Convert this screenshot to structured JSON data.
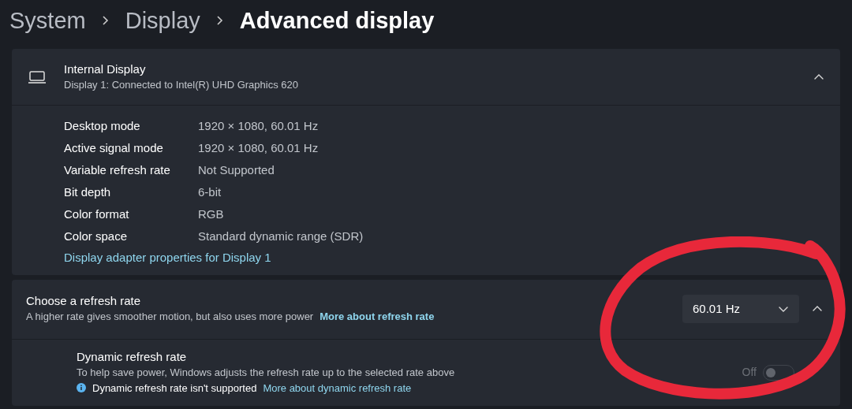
{
  "breadcrumb": [
    "System",
    "Display",
    "Advanced display"
  ],
  "display_card": {
    "title": "Internal Display",
    "subtitle": "Display 1: Connected to Intel(R) UHD Graphics 620",
    "expanded": true,
    "details": [
      {
        "label": "Desktop mode",
        "value": "1920 × 1080, 60.01 Hz"
      },
      {
        "label": "Active signal mode",
        "value": "1920 × 1080, 60.01 Hz"
      },
      {
        "label": "Variable refresh rate",
        "value": "Not Supported"
      },
      {
        "label": "Bit depth",
        "value": "6-bit"
      },
      {
        "label": "Color format",
        "value": "RGB"
      },
      {
        "label": "Color space",
        "value": "Standard dynamic range (SDR)"
      }
    ],
    "link": "Display adapter properties for Display 1"
  },
  "refresh_card": {
    "title": "Choose a refresh rate",
    "description": "A higher rate gives smoother motion, but also uses more power",
    "link": "More about refresh rate",
    "dropdown": "60.01 Hz",
    "expanded": true,
    "dynamic": {
      "title": "Dynamic refresh rate",
      "description": "To help save power, Windows adjusts the refresh rate up to the selected rate above",
      "note": "Dynamic refresh rate isn't supported",
      "link": "More about dynamic refresh rate",
      "toggle_label": "Off",
      "on": false,
      "disabled": true
    }
  }
}
